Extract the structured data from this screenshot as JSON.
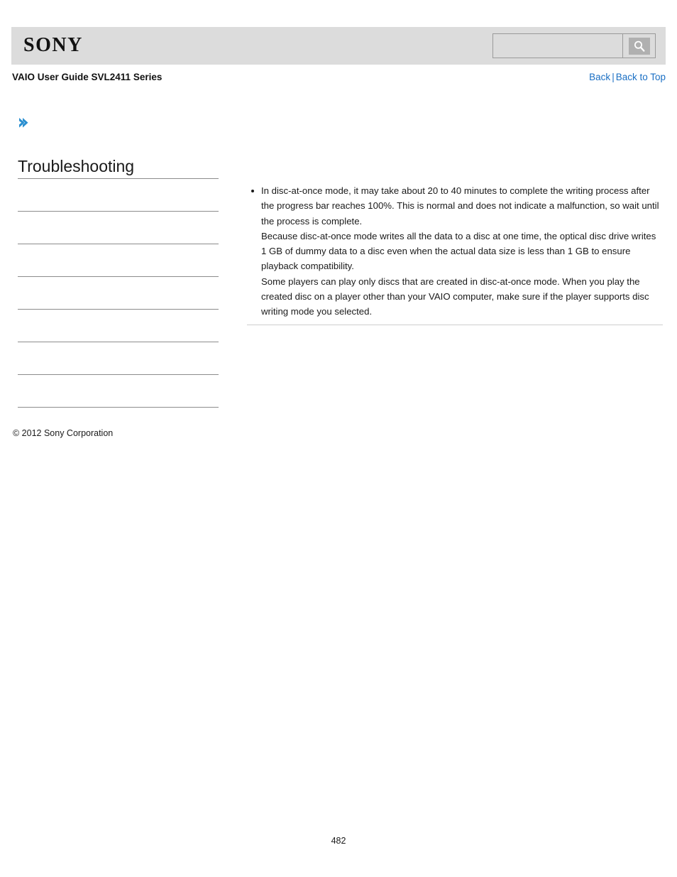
{
  "header": {
    "logo_text": "SONY",
    "search": {
      "value": "",
      "placeholder": "",
      "icon": "search-icon",
      "button_label": ""
    }
  },
  "subheader": {
    "guide_title": "VAIO User Guide SVL2411 Series",
    "links": {
      "back": "Back",
      "separator": "|",
      "back_to_top": "Back to Top"
    }
  },
  "breadcrumb": {
    "icon": "chevron-right-icon",
    "color": "#2a8fd0",
    "text": ""
  },
  "sidebar": {
    "title": "Troubleshooting",
    "items": [
      {
        "label": ""
      },
      {
        "label": ""
      },
      {
        "label": ""
      },
      {
        "label": ""
      },
      {
        "label": ""
      },
      {
        "label": ""
      },
      {
        "label": ""
      }
    ],
    "copyright": "© 2012 Sony Corporation"
  },
  "main": {
    "bullets": [
      {
        "paragraphs": [
          "In disc-at-once mode, it may take about 20 to 40 minutes to complete the writing process after the progress bar reaches 100%. This is normal and does not indicate a malfunction, so wait until the process is complete.",
          "Because disc-at-once mode writes all the data to a disc at one time, the optical disc drive writes 1 GB of dummy data to a disc even when the actual data size is less than 1 GB to ensure playback compatibility.",
          "Some players can play only discs that are created in disc-at-once mode. When you play the created disc on a player other than your VAIO computer, make sure if the player supports disc writing mode you selected."
        ]
      }
    ]
  },
  "footer": {
    "page_number": "482"
  },
  "colors": {
    "link": "#1a6fc4",
    "header_bar": "#dcdcdc",
    "accent": "#2a8fd0",
    "rule": "#8c8c8c"
  }
}
